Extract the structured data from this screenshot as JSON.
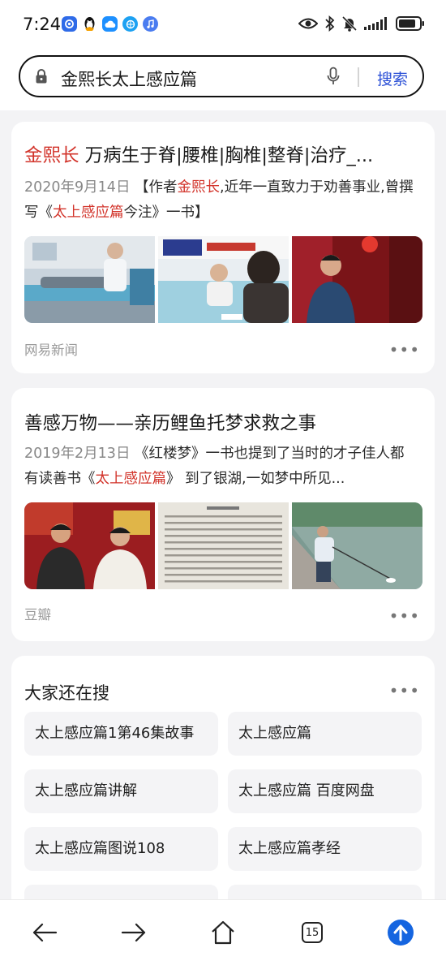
{
  "status_bar": {
    "time": "7:24",
    "notification_apps": [
      "baidu-app-icon",
      "qq-penguin-icon",
      "cloud-app-icon",
      "browser-app-icon",
      "music-app-icon"
    ],
    "battery_level": 0.85
  },
  "search": {
    "query": "金熙长太上感应篇",
    "button_label": "搜索"
  },
  "results": [
    {
      "title_highlight": "金熙长",
      "title_rest": " 万病生于脊|腰椎|胸椎|整脊|治疗_...",
      "date": "2020年9月14日",
      "snippet_parts": [
        " 【作者",
        "金熙长",
        ",近年一直致力于劝善事业,曾撰写《",
        "太上感应篇",
        "今注》一书】"
      ],
      "source": "网易新闻",
      "images": [
        "massage-therapy-photo",
        "interview-photo",
        "portrait-photo"
      ]
    },
    {
      "title": "善感万物——亲历鲤鱼托梦求救之事",
      "date": "2019年2月13日",
      "snippet_parts": [
        " 《红楼梦》一书也提到了当时的才子佳人都有读善书《",
        "太上感应篇",
        "》 到了银湖,一如梦中所见..."
      ],
      "source": "豆瓣",
      "images": [
        "two-men-photo",
        "book-page-photo",
        "lake-fishing-photo"
      ]
    }
  ],
  "related": {
    "title": "大家还在搜",
    "items": [
      "太上感应篇1第46集故事",
      "太上感应篇",
      "太上感应篇讲解",
      "太上感应篇 百度网盘",
      "太上感应篇图说108",
      "太上感应篇孝经"
    ]
  },
  "bottom_nav": {
    "tab_count": "15"
  },
  "colors": {
    "highlight": "#d2332a",
    "link_blue": "#2a4fd6",
    "upload_blue": "#1565e0"
  }
}
